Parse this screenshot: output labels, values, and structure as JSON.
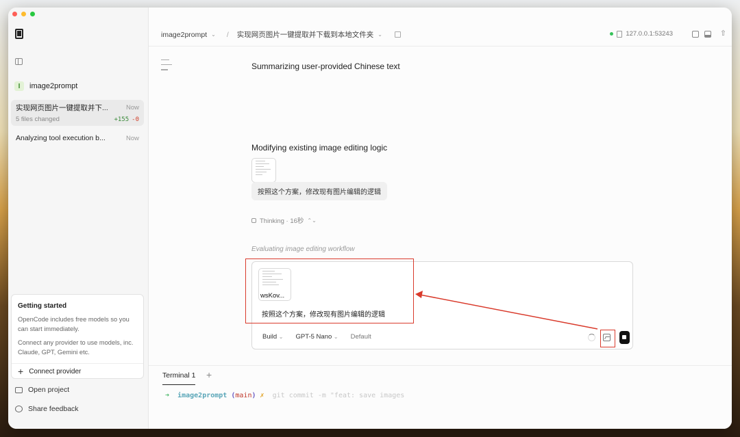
{
  "window": {
    "traffic_lights": [
      "close",
      "minimize",
      "zoom"
    ]
  },
  "sidebar": {
    "project": {
      "badge": "I",
      "name": "image2prompt"
    },
    "sessions": [
      {
        "title": "实现网页图片一键提取并下...",
        "time": "Now",
        "sub": "5 files changed",
        "added": "+155",
        "removed": "-0"
      },
      {
        "title": "Analyzing tool execution b...",
        "time": "Now"
      }
    ],
    "getting_started": {
      "title": "Getting started",
      "p1": "OpenCode includes free models so you can start immediately.",
      "p2": "Connect any provider to use models, inc. Claude, GPT, Gemini etc.",
      "connect": "Connect provider"
    },
    "open_project": "Open project",
    "share_feedback": "Share feedback"
  },
  "topbar": {
    "project": "image2prompt",
    "separator": "/",
    "session": "实现网页图片一键提取并下载到本地文件夹",
    "server": "127.0.0.1:53243"
  },
  "conversation": {
    "heading1": "Summarizing user-provided Chinese text",
    "heading2": "Modifying existing image editing logic",
    "user_message": "按照这个方案，修改现有图片编辑的逻辑",
    "thinking": "Thinking · 16秒",
    "status": "Evaluating image editing workflow"
  },
  "composer": {
    "attachment_label": "wsKov...",
    "text": "按照这个方案，修改现有图片编辑的逻辑",
    "agent": "Build",
    "model": "GPT-5 Nano",
    "variant": "Default"
  },
  "terminal": {
    "tab": "Terminal 1",
    "prompt_arrow": "➜",
    "dir": "image2prompt",
    "git_open": "(",
    "branch": "main",
    "git_close": ")",
    "dirty": "✗",
    "command": "git commit -m \"feat: save images"
  },
  "colors": {
    "annotation": "#d93a2b",
    "accent_green": "#37c25a"
  }
}
